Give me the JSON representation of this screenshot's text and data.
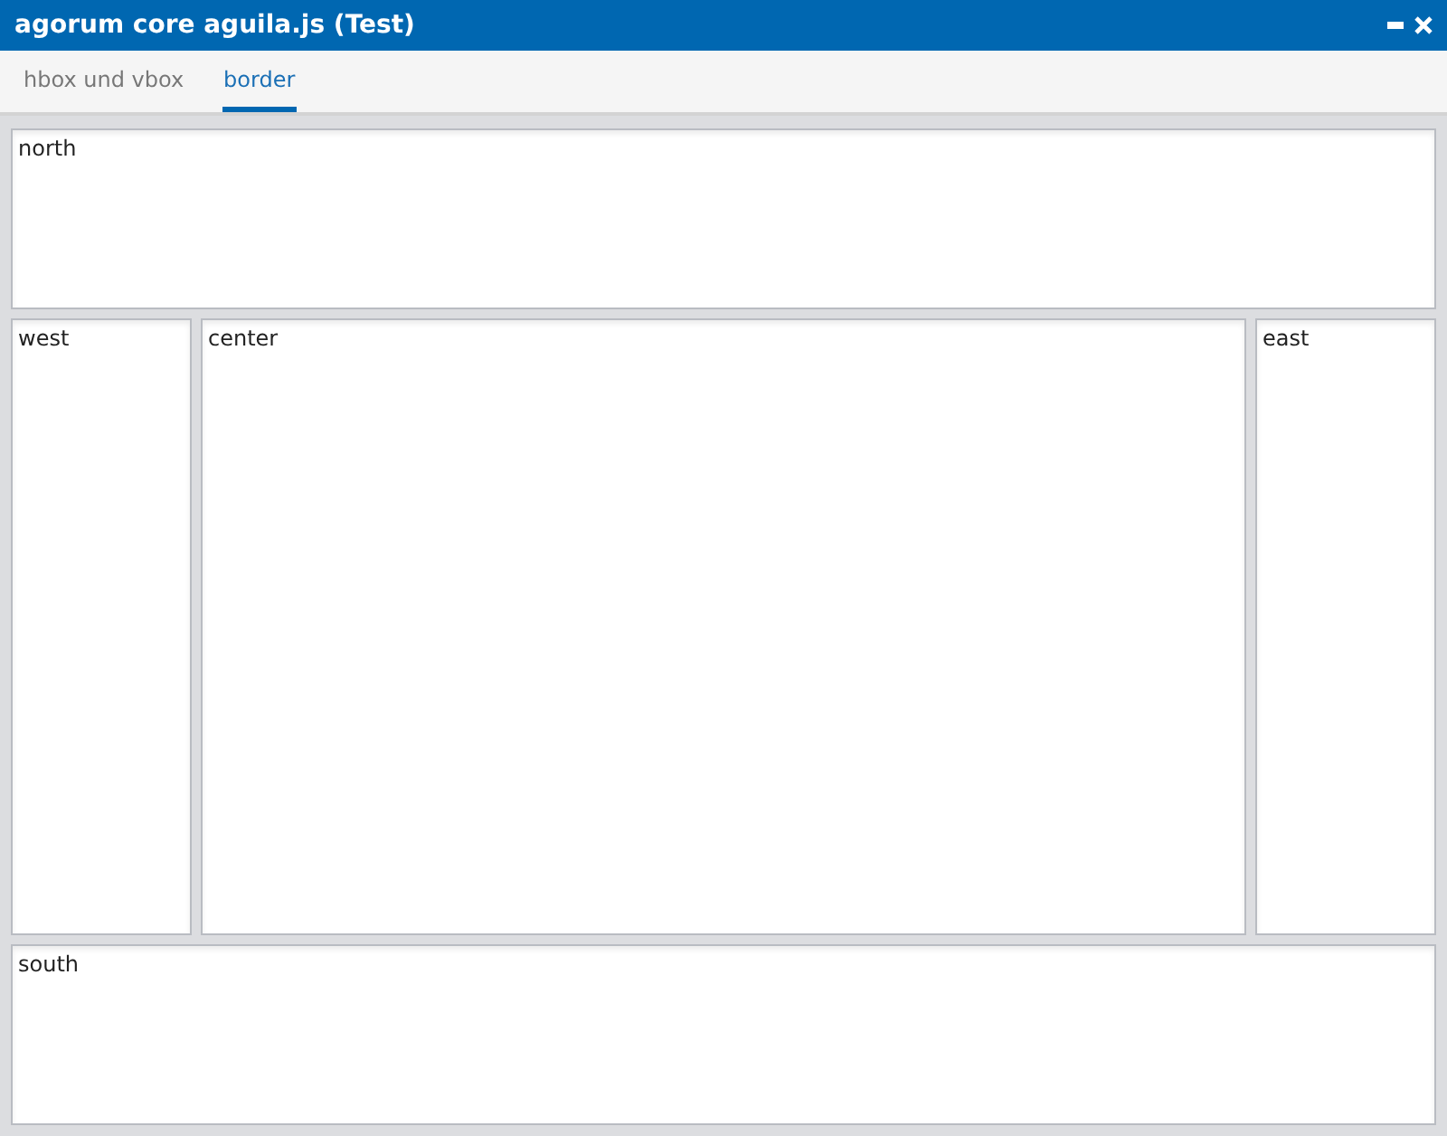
{
  "window": {
    "title": "agorum core aguila.js (Test)"
  },
  "tabs": [
    {
      "label": "hbox und vbox",
      "selected": false
    },
    {
      "label": "border",
      "selected": true
    }
  ],
  "panels": [
    {
      "kind": "north",
      "label": "north"
    },
    {
      "kind": "west",
      "label": "west"
    },
    {
      "kind": "center",
      "label": "center"
    },
    {
      "kind": "east",
      "label": "east"
    },
    {
      "kind": "south",
      "label": "south"
    }
  ]
}
